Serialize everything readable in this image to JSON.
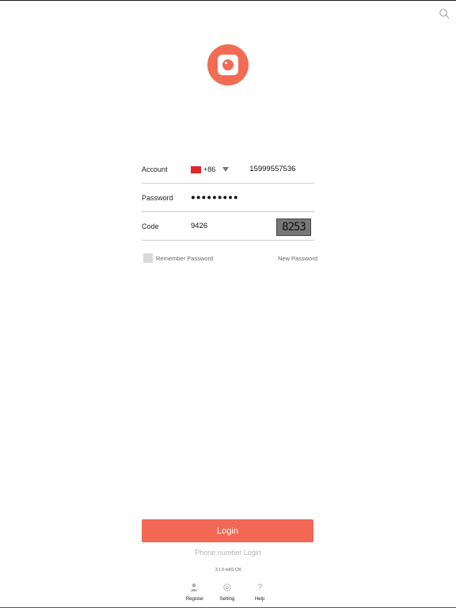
{
  "brand": {
    "accent_color": "#f26b55",
    "logo_icon": "camera-app-logo"
  },
  "header": {
    "search_icon": "search-icon"
  },
  "form": {
    "account_label": "Account",
    "country_code": "+86",
    "phone_number": "15999557536",
    "password_label": "Password",
    "password_masked": "●●●●●●●●●",
    "code_label": "Code",
    "code_value": "9426",
    "captcha_text": "8253"
  },
  "options": {
    "remember_label": "Remember Password",
    "new_password_label": "New Password"
  },
  "actions": {
    "login_label": "Login",
    "phone_login_label": "Phone number Login"
  },
  "version": "3.1.5 rel01 CN",
  "tabs": [
    {
      "label": "Register",
      "icon": "user-icon"
    },
    {
      "label": "Setting",
      "icon": "gear-icon"
    },
    {
      "label": "Help",
      "icon": "help-icon"
    }
  ]
}
